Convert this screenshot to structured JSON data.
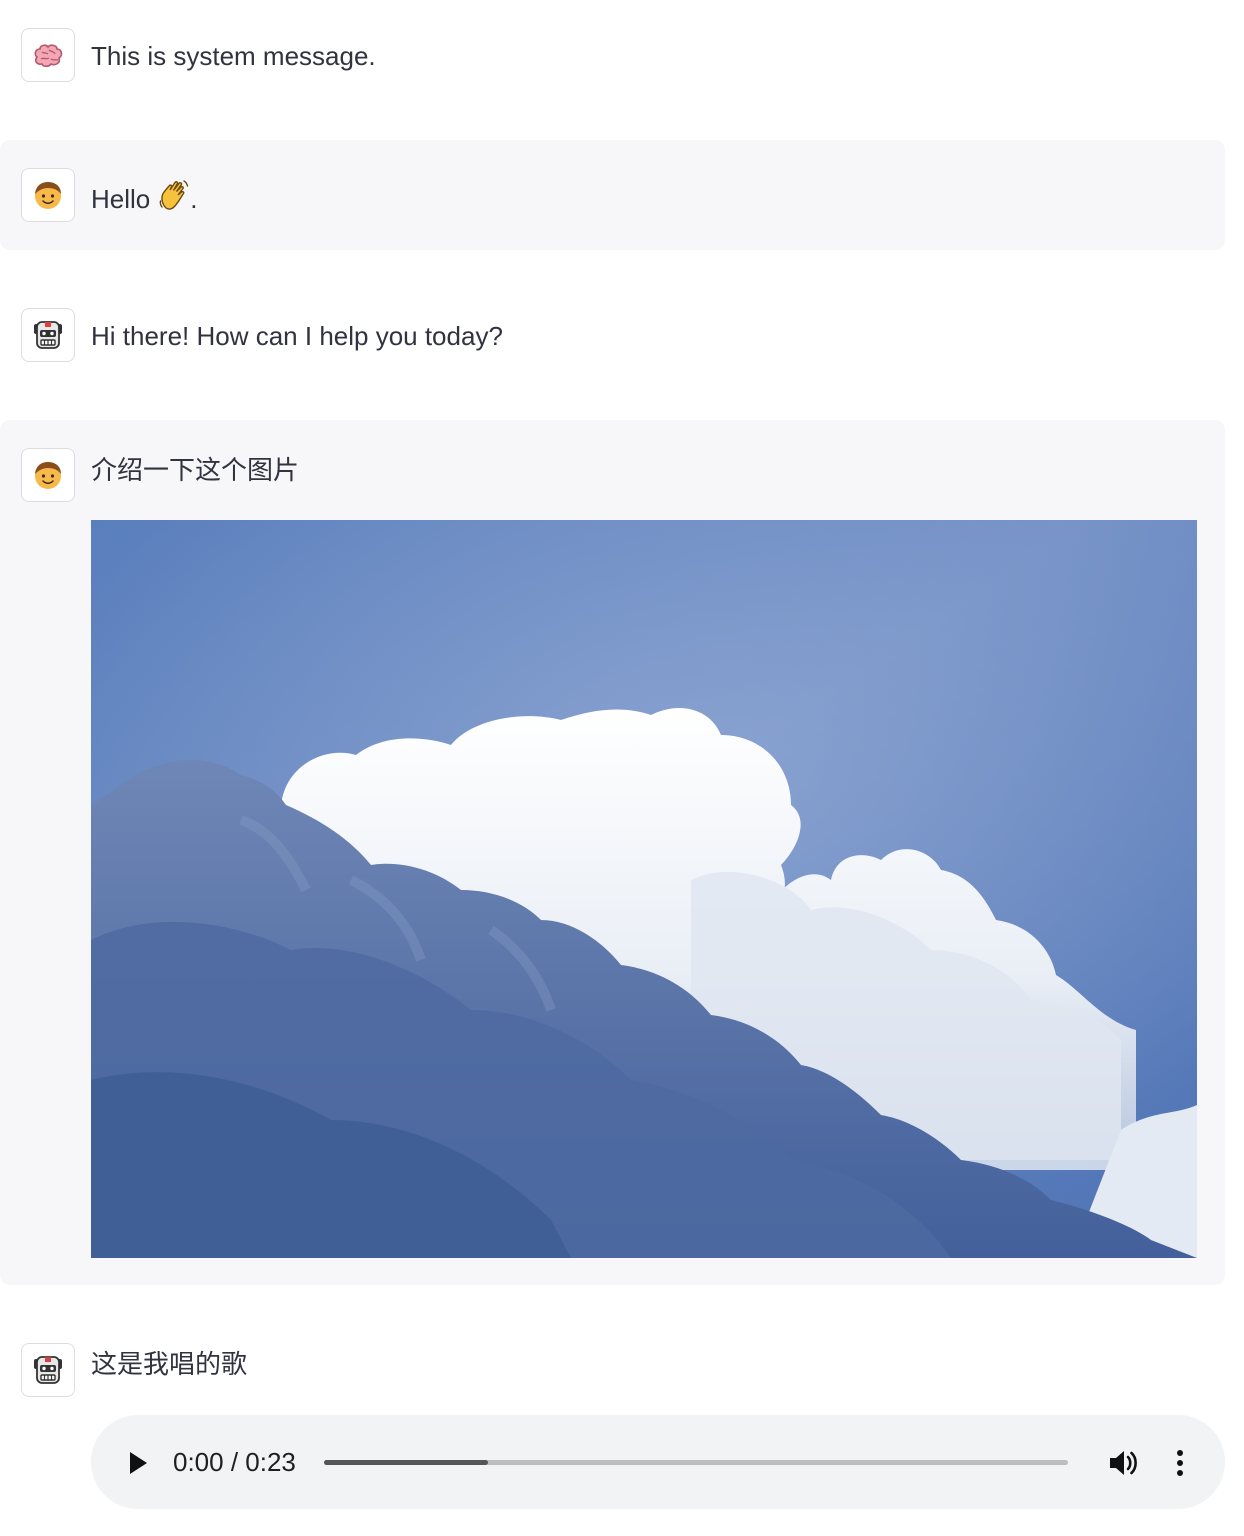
{
  "messages": [
    {
      "role": "system",
      "avatar_icon": "brain-icon",
      "text": "This is system message."
    },
    {
      "role": "user",
      "avatar_icon": "boy-face-icon",
      "text": "Hello",
      "suffix": ".",
      "emoji_icon": "waving-hand-icon"
    },
    {
      "role": "assistant",
      "avatar_icon": "robot-face-icon",
      "text": "Hi there! How can I help you today?"
    },
    {
      "role": "user",
      "avatar_icon": "boy-face-icon",
      "text": "介绍一下这个图片",
      "attachment": "cloud-sky-image"
    },
    {
      "role": "assistant",
      "avatar_icon": "robot-face-icon",
      "text": "这是我唱的歌",
      "attachment": "audio-player"
    }
  ],
  "audio_player": {
    "time_display": "0:00 / 0:23",
    "progress_fraction": 0.22,
    "play_icon": "play-icon",
    "volume_icon": "volume-icon",
    "menu_icon": "more-vertical-icon"
  },
  "colors": {
    "shaded_bg": "#f7f7f9",
    "text": "#31333f",
    "avatar_border": "#dcdde3",
    "audio_bg": "#f1f3f4"
  }
}
